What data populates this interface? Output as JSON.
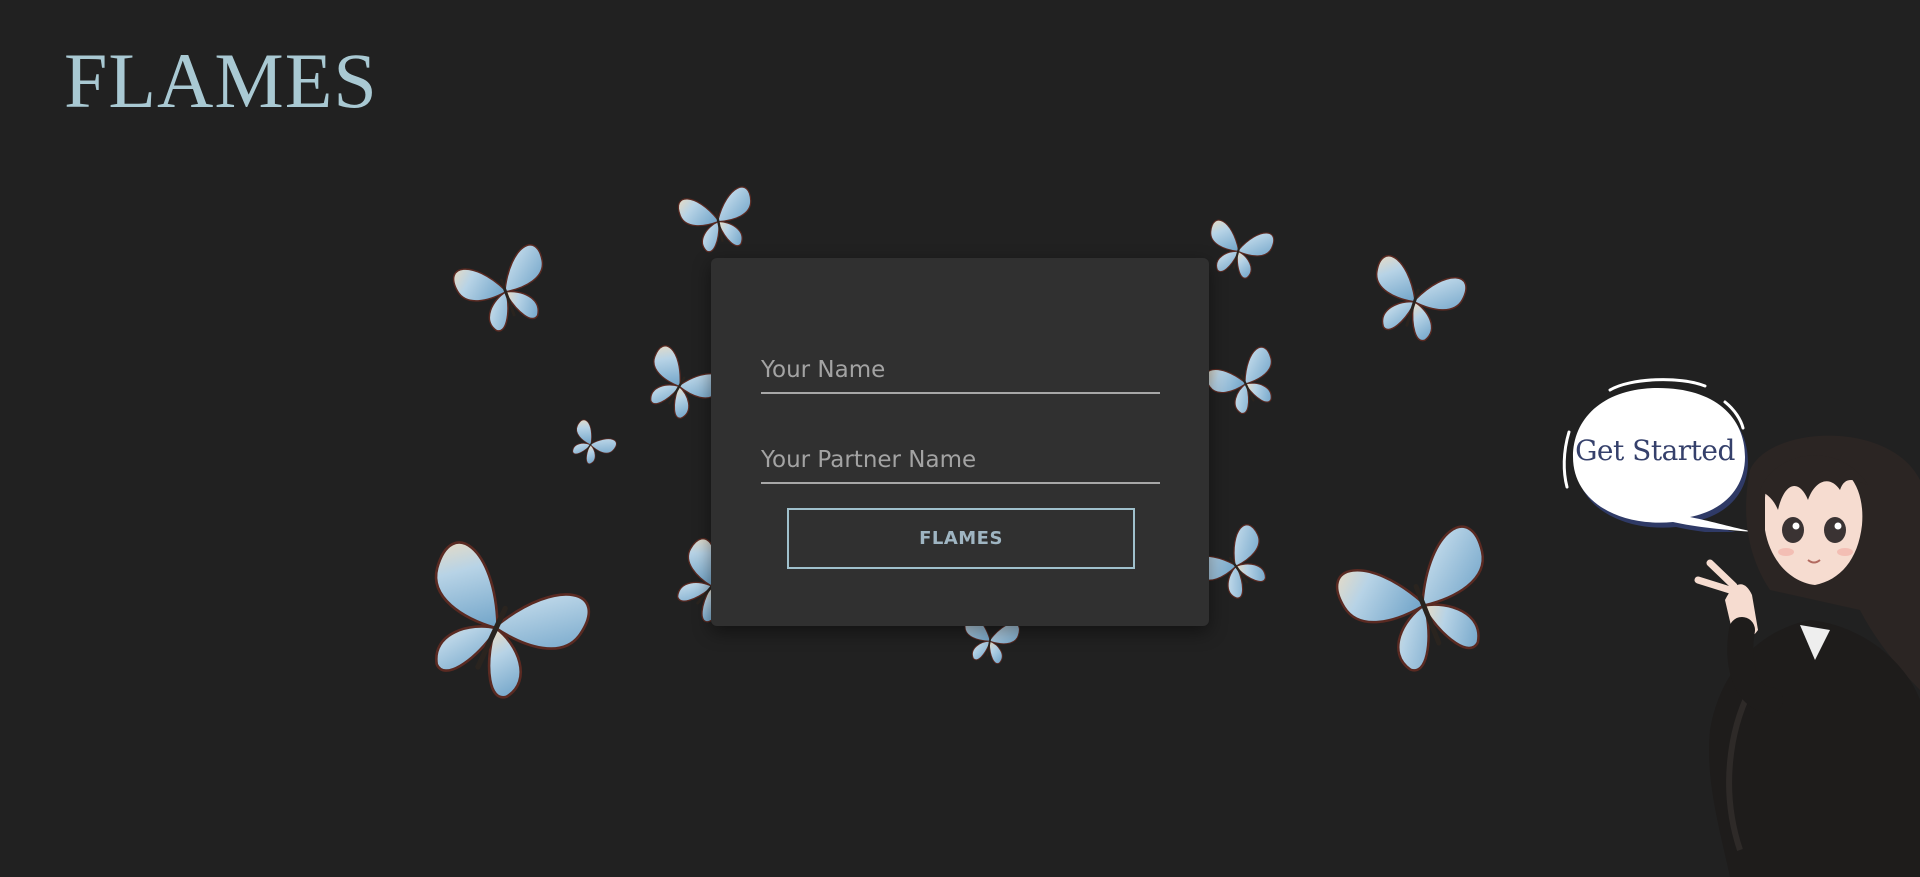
{
  "header": {
    "logo_text": "FLAMES"
  },
  "form": {
    "name_placeholder": "Your Name",
    "partner_placeholder": "Your Partner Name",
    "submit_label": "FLAMES"
  },
  "mascot": {
    "speech_bubble_text": "Get Started"
  },
  "decorations": {
    "icon": "butterfly-icon",
    "wing_color": "#8fb9d6",
    "edge_color": "#e6d2b5"
  },
  "colors": {
    "background": "#212121",
    "card": "#303030",
    "accent": "#a9c9d3",
    "bubble_text": "#35406b"
  }
}
